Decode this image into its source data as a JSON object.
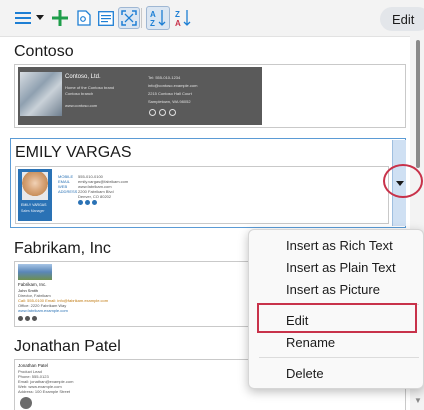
{
  "toolbar": {
    "edit_label": "Edit",
    "icons": [
      "list-menu-icon",
      "dropdown-arrow-icon",
      "add-icon",
      "document-icon",
      "preview-icon",
      "fit-icon",
      "sort-az-icon",
      "sort-za-icon"
    ]
  },
  "signatures": [
    {
      "name": "Contoso",
      "card_company": "Contoso, Ltd.",
      "card_lines": [
        "Home of the Contoso brand",
        "Contoso branch",
        "www.contoso.com"
      ],
      "card_right": [
        "Tel: 555-010-1234",
        "info@contoso.example.com",
        "2215 Contoso Hall Court",
        "Sampletown, WA 98052"
      ]
    },
    {
      "name": "EMILY VARGAS",
      "card_name": "EMILY VARGAS",
      "card_title": "Sales Manager",
      "labels": [
        "MOBILE",
        "EMAIL",
        "WEB",
        "ADDRESS"
      ],
      "values": [
        "555-010-0100",
        "emily.vargas@fabrikam.com",
        "www.fabrikam.com",
        "2200 Fabrikam Blvd",
        "Denver, CO 80202"
      ]
    },
    {
      "name": "Fabrikam, Inc",
      "card_lines": [
        "Fabrikam, Inc.",
        "John Smith",
        "Director, Fabrikam",
        "Call: 555-0100  Email: info@fabrikam.example.com",
        "Office: 2220 Fabrikam Way",
        "www.fabrikam.example.com"
      ]
    },
    {
      "name": "Jonathan Patel",
      "card_lines": [
        "Jonathan Patel",
        "Product Lead",
        "Phone: 555-0123",
        "Email: jonathan@example.com",
        "Web: www.example.com",
        "Address: 100 Example Street"
      ]
    }
  ],
  "context_menu": {
    "items": [
      "Insert as Rich Text",
      "Insert as Plain Text",
      "Insert as Picture",
      "Edit",
      "Rename",
      "Delete"
    ]
  },
  "colors": {
    "accent": "#1e7fd4",
    "highlight_ring": "#c8324a",
    "selection_border": "#5b9bd5",
    "add_green": "#1e9e4a",
    "contoso_card_bg": "#5a5a5a",
    "emily_blue": "#2a72b5"
  }
}
